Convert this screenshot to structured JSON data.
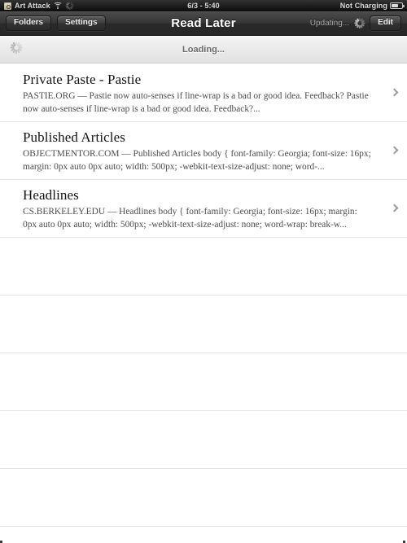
{
  "status_bar": {
    "carrier": "Art Attack",
    "rotation_lock_icon": "rotation-lock-icon",
    "wifi_icon": "wifi-icon",
    "activity_icon": "activity-spinner-icon",
    "time": "6/3 - 5:40",
    "battery_text": "Not Charging",
    "battery_icon": "battery-icon"
  },
  "nav_bar": {
    "title": "Read Later",
    "folders_label": "Folders",
    "settings_label": "Settings",
    "updating_label": "Updating...",
    "edit_label": "Edit",
    "spinner_icon": "activity-spinner-icon"
  },
  "loading_header": {
    "label": "Loading...",
    "spinner_icon": "activity-spinner-icon"
  },
  "list": {
    "chevron_icon": "chevron-right-icon",
    "items": [
      {
        "title": "Private Paste - Pastie",
        "excerpt": "PASTIE.ORG — Pastie now auto-senses if line-wrap is a bad or good idea. Feedback? Pastie now auto-senses if line-wrap is a bad or good idea. Feedback?..."
      },
      {
        "title": "Published Articles",
        "excerpt": "OBJECTMENTOR.COM — Published Articles body { font-family: Georgia; font-size: 16px; margin: 0px auto 0px auto; width: 500px; -webkit-text-size-adjust: none; word-..."
      },
      {
        "title": "Headlines",
        "excerpt": "CS.BERKELEY.EDU — Headlines body { font-family: Georgia; font-size: 16px; margin: 0px auto 0px auto; width: 500px; -webkit-text-size-adjust: none; word-wrap: break-w..."
      }
    ],
    "empty_row_count": 5
  },
  "colors": {
    "status_bar_bg": "#1c1c1c",
    "nav_bar_bg": "#363636",
    "loading_bar_bg": "#ebebeb",
    "row_separator": "#e4e4e4",
    "title_text": "#141414",
    "excerpt_text": "#4c4c4c",
    "chevron": "#9a9a9a"
  }
}
